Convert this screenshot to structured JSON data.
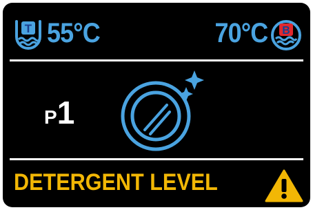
{
  "temperatures": {
    "wash_tank": {
      "icon": "tank-t-icon",
      "badge_letter": "T",
      "value": "55°C"
    },
    "boiler": {
      "icon": "tank-b-icon",
      "badge_letter": "B",
      "value": "70°C"
    }
  },
  "program": {
    "prefix": "P",
    "number": "1",
    "icon": "plate-icon"
  },
  "alert": {
    "message": "DETERGENT LEVEL",
    "icon": "warning-icon"
  },
  "colors": {
    "background": "#000000",
    "temperature_text": "#4aa3e0",
    "alert_text": "#f2b705",
    "boiler_badge": "#e0282e",
    "warning_triangle": "#f2b705"
  }
}
